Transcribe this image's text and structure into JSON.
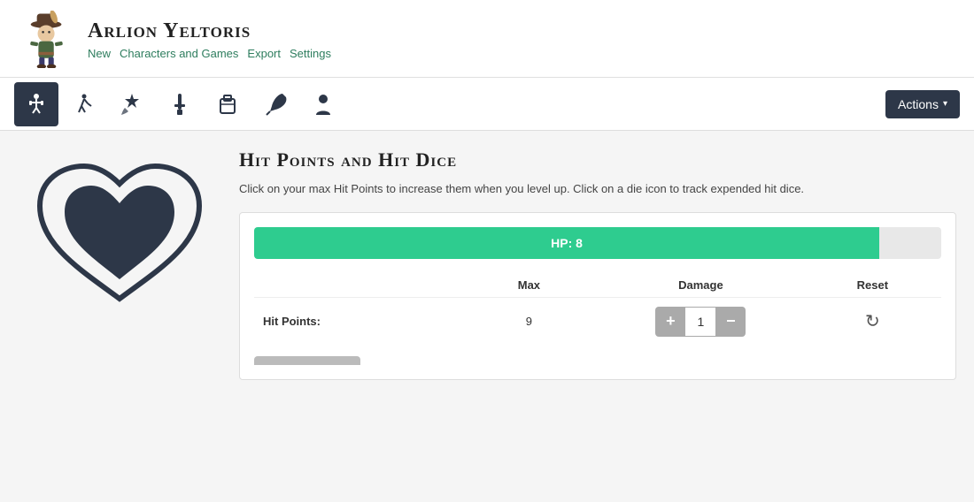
{
  "header": {
    "character_name": "Arlion Yeltoris",
    "nav": [
      {
        "label": "New",
        "href": "#"
      },
      {
        "label": "Characters and Games",
        "href": "#"
      },
      {
        "label": "Export",
        "href": "#"
      },
      {
        "label": "Settings",
        "href": "#"
      }
    ]
  },
  "toolbar": {
    "icons": [
      {
        "name": "combat-icon",
        "symbol": "🏋",
        "active": true
      },
      {
        "name": "movement-icon",
        "symbol": "🏃",
        "active": false
      },
      {
        "name": "magic-icon",
        "symbol": "✨",
        "active": false
      },
      {
        "name": "weapon-icon",
        "symbol": "🗡",
        "active": false
      },
      {
        "name": "inventory-icon",
        "symbol": "🎒",
        "active": false
      },
      {
        "name": "quill-icon",
        "symbol": "✒",
        "active": false
      },
      {
        "name": "character-icon",
        "symbol": "🧙",
        "active": false
      }
    ],
    "actions_label": "Actions",
    "actions_caret": "▾"
  },
  "main": {
    "section_title": "Hit Points and Hit Dice",
    "section_desc": "Click on your max Hit Points to increase them when you level up. Click on a die icon to track expended hit dice.",
    "hp_bar": {
      "label": "HP: 8",
      "fill_percent": 91
    },
    "table": {
      "headers": [
        "",
        "Max",
        "Damage",
        "Reset"
      ],
      "rows": [
        {
          "label": "Hit Points:",
          "max": "9",
          "damage_value": "1",
          "reset_symbol": "↻"
        }
      ]
    },
    "dmg_plus": "+",
    "dmg_minus": "−"
  }
}
